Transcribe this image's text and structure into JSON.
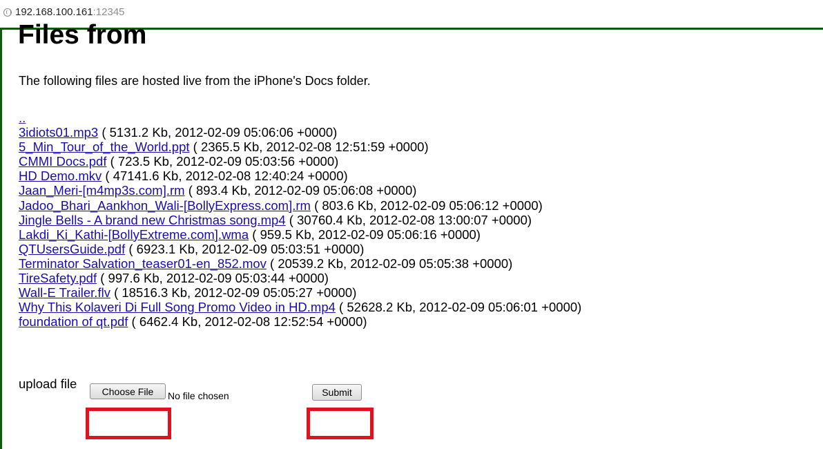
{
  "browser": {
    "url_host": "192.168.100.161",
    "url_port": ":12345",
    "accent_border_color": "#0d5a0d"
  },
  "page": {
    "title": "Files from",
    "description": "The following files are hosted live from the iPhone's Docs folder.",
    "parent_link": ".."
  },
  "files": [
    {
      "name": "3idiots01.mp3",
      "info": " ( 5131.2 Kb, 2012-02-09 05:06:06 +0000)"
    },
    {
      "name": "5_Min_Tour_of_the_World.ppt",
      "info": " ( 2365.5 Kb, 2012-02-08 12:51:59 +0000)"
    },
    {
      "name": "CMMI Docs.pdf",
      "info": " ( 723.5 Kb, 2012-02-09 05:03:56 +0000)"
    },
    {
      "name": "HD Demo.mkv",
      "info": " ( 47141.6 Kb, 2012-02-08 12:40:24 +0000)"
    },
    {
      "name": "Jaan_Meri-[m4mp3s.com].rm",
      "info": " ( 893.4 Kb, 2012-02-09 05:06:08 +0000)"
    },
    {
      "name": "Jadoo_Bhari_Aankhon_Wali-[BollyExpress.com].rm",
      "info": " ( 803.6 Kb, 2012-02-09 05:06:12 +0000)"
    },
    {
      "name": "Jingle Bells - A brand new Christmas song.mp4",
      "info": " ( 30760.4 Kb, 2012-02-08 13:00:07 +0000)"
    },
    {
      "name": "Lakdi_Ki_Kathi-[BollyExtreme.com].wma",
      "info": " ( 959.5 Kb, 2012-02-09 05:06:16 +0000)"
    },
    {
      "name": "QTUsersGuide.pdf",
      "info": " ( 6923.1 Kb, 2012-02-09 05:03:51 +0000)"
    },
    {
      "name": "Terminator Salvation_teaser01-en_852.mov",
      "info": " ( 20539.2 Kb, 2012-02-09 05:05:38 +0000)"
    },
    {
      "name": "TireSafety.pdf",
      "info": " ( 997.6 Kb, 2012-02-09 05:03:44 +0000)"
    },
    {
      "name": "Wall-E Trailer.flv",
      "info": " ( 18516.3 Kb, 2012-02-09 05:05:27 +0000)"
    },
    {
      "name": "Why This Kolaveri Di Full Song Promo Video in HD.mp4",
      "info": " ( 52628.2 Kb, 2012-02-09 05:06:01 +0000)"
    },
    {
      "name": "foundation of qt.pdf",
      "info": " ( 6462.4 Kb, 2012-02-08 12:52:54 +0000)"
    }
  ],
  "upload": {
    "label": "upload file",
    "choose_button": "Choose File",
    "no_file_text": "No file chosen",
    "submit_button": "Submit",
    "highlight_color": "#e0121e"
  }
}
